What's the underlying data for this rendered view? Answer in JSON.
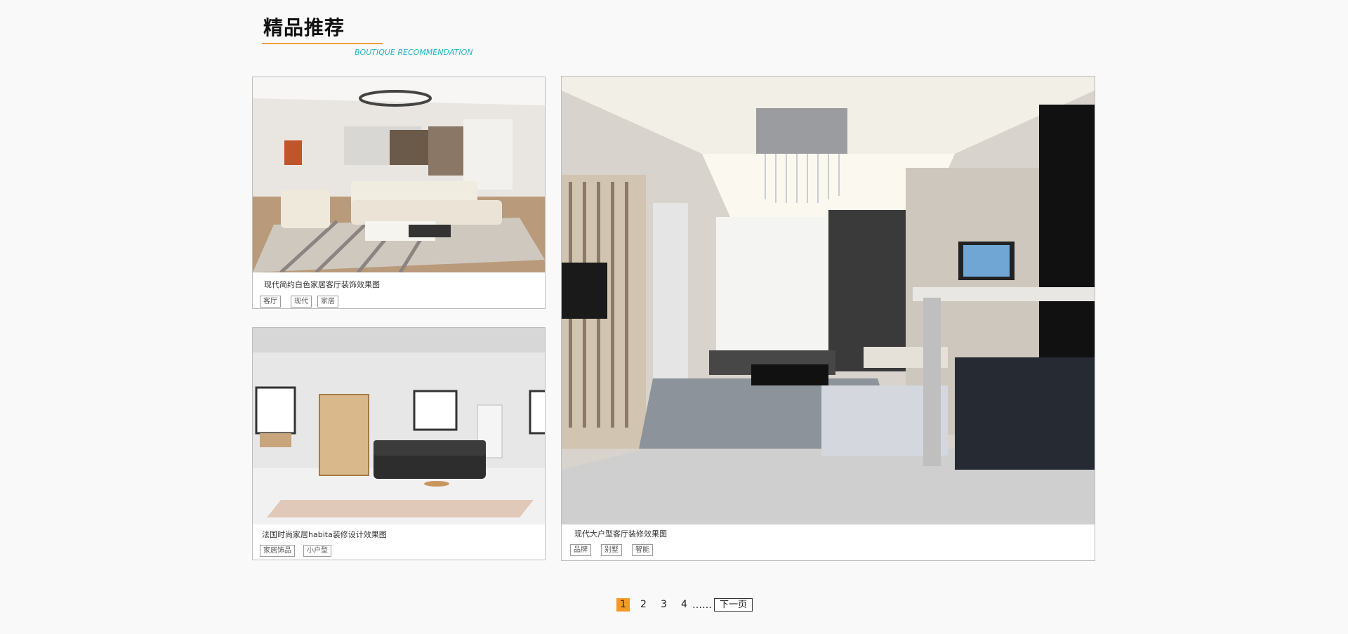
{
  "section": {
    "title": "精品推荐",
    "subtitle": "BOUTIQUE RECOMMENDATION"
  },
  "cards": [
    {
      "caption": "现代简约白色家居客厅装饰效果图",
      "tags": [
        "客厅",
        "现代",
        "家居"
      ],
      "image": "modern-white-living-room-photo"
    },
    {
      "caption": "法国时尚家居habita装修设计效果图",
      "tags": [
        "家居饰品",
        "小户型"
      ],
      "image": "french-habita-living-room-photo"
    },
    {
      "caption": "现代大户型客厅装修效果图",
      "tags": [
        "品牌",
        "别墅",
        "智能"
      ],
      "image": "large-modern-living-room-photo"
    }
  ],
  "pagination": {
    "pages": [
      "1",
      "2",
      "3",
      "4"
    ],
    "active": "1",
    "ellipsis": "……",
    "next": "下一页"
  },
  "colors": {
    "accent_orange": "#f39a26",
    "subtitle_teal": "#1fb5c2",
    "border_gray": "#bdbdbd"
  }
}
